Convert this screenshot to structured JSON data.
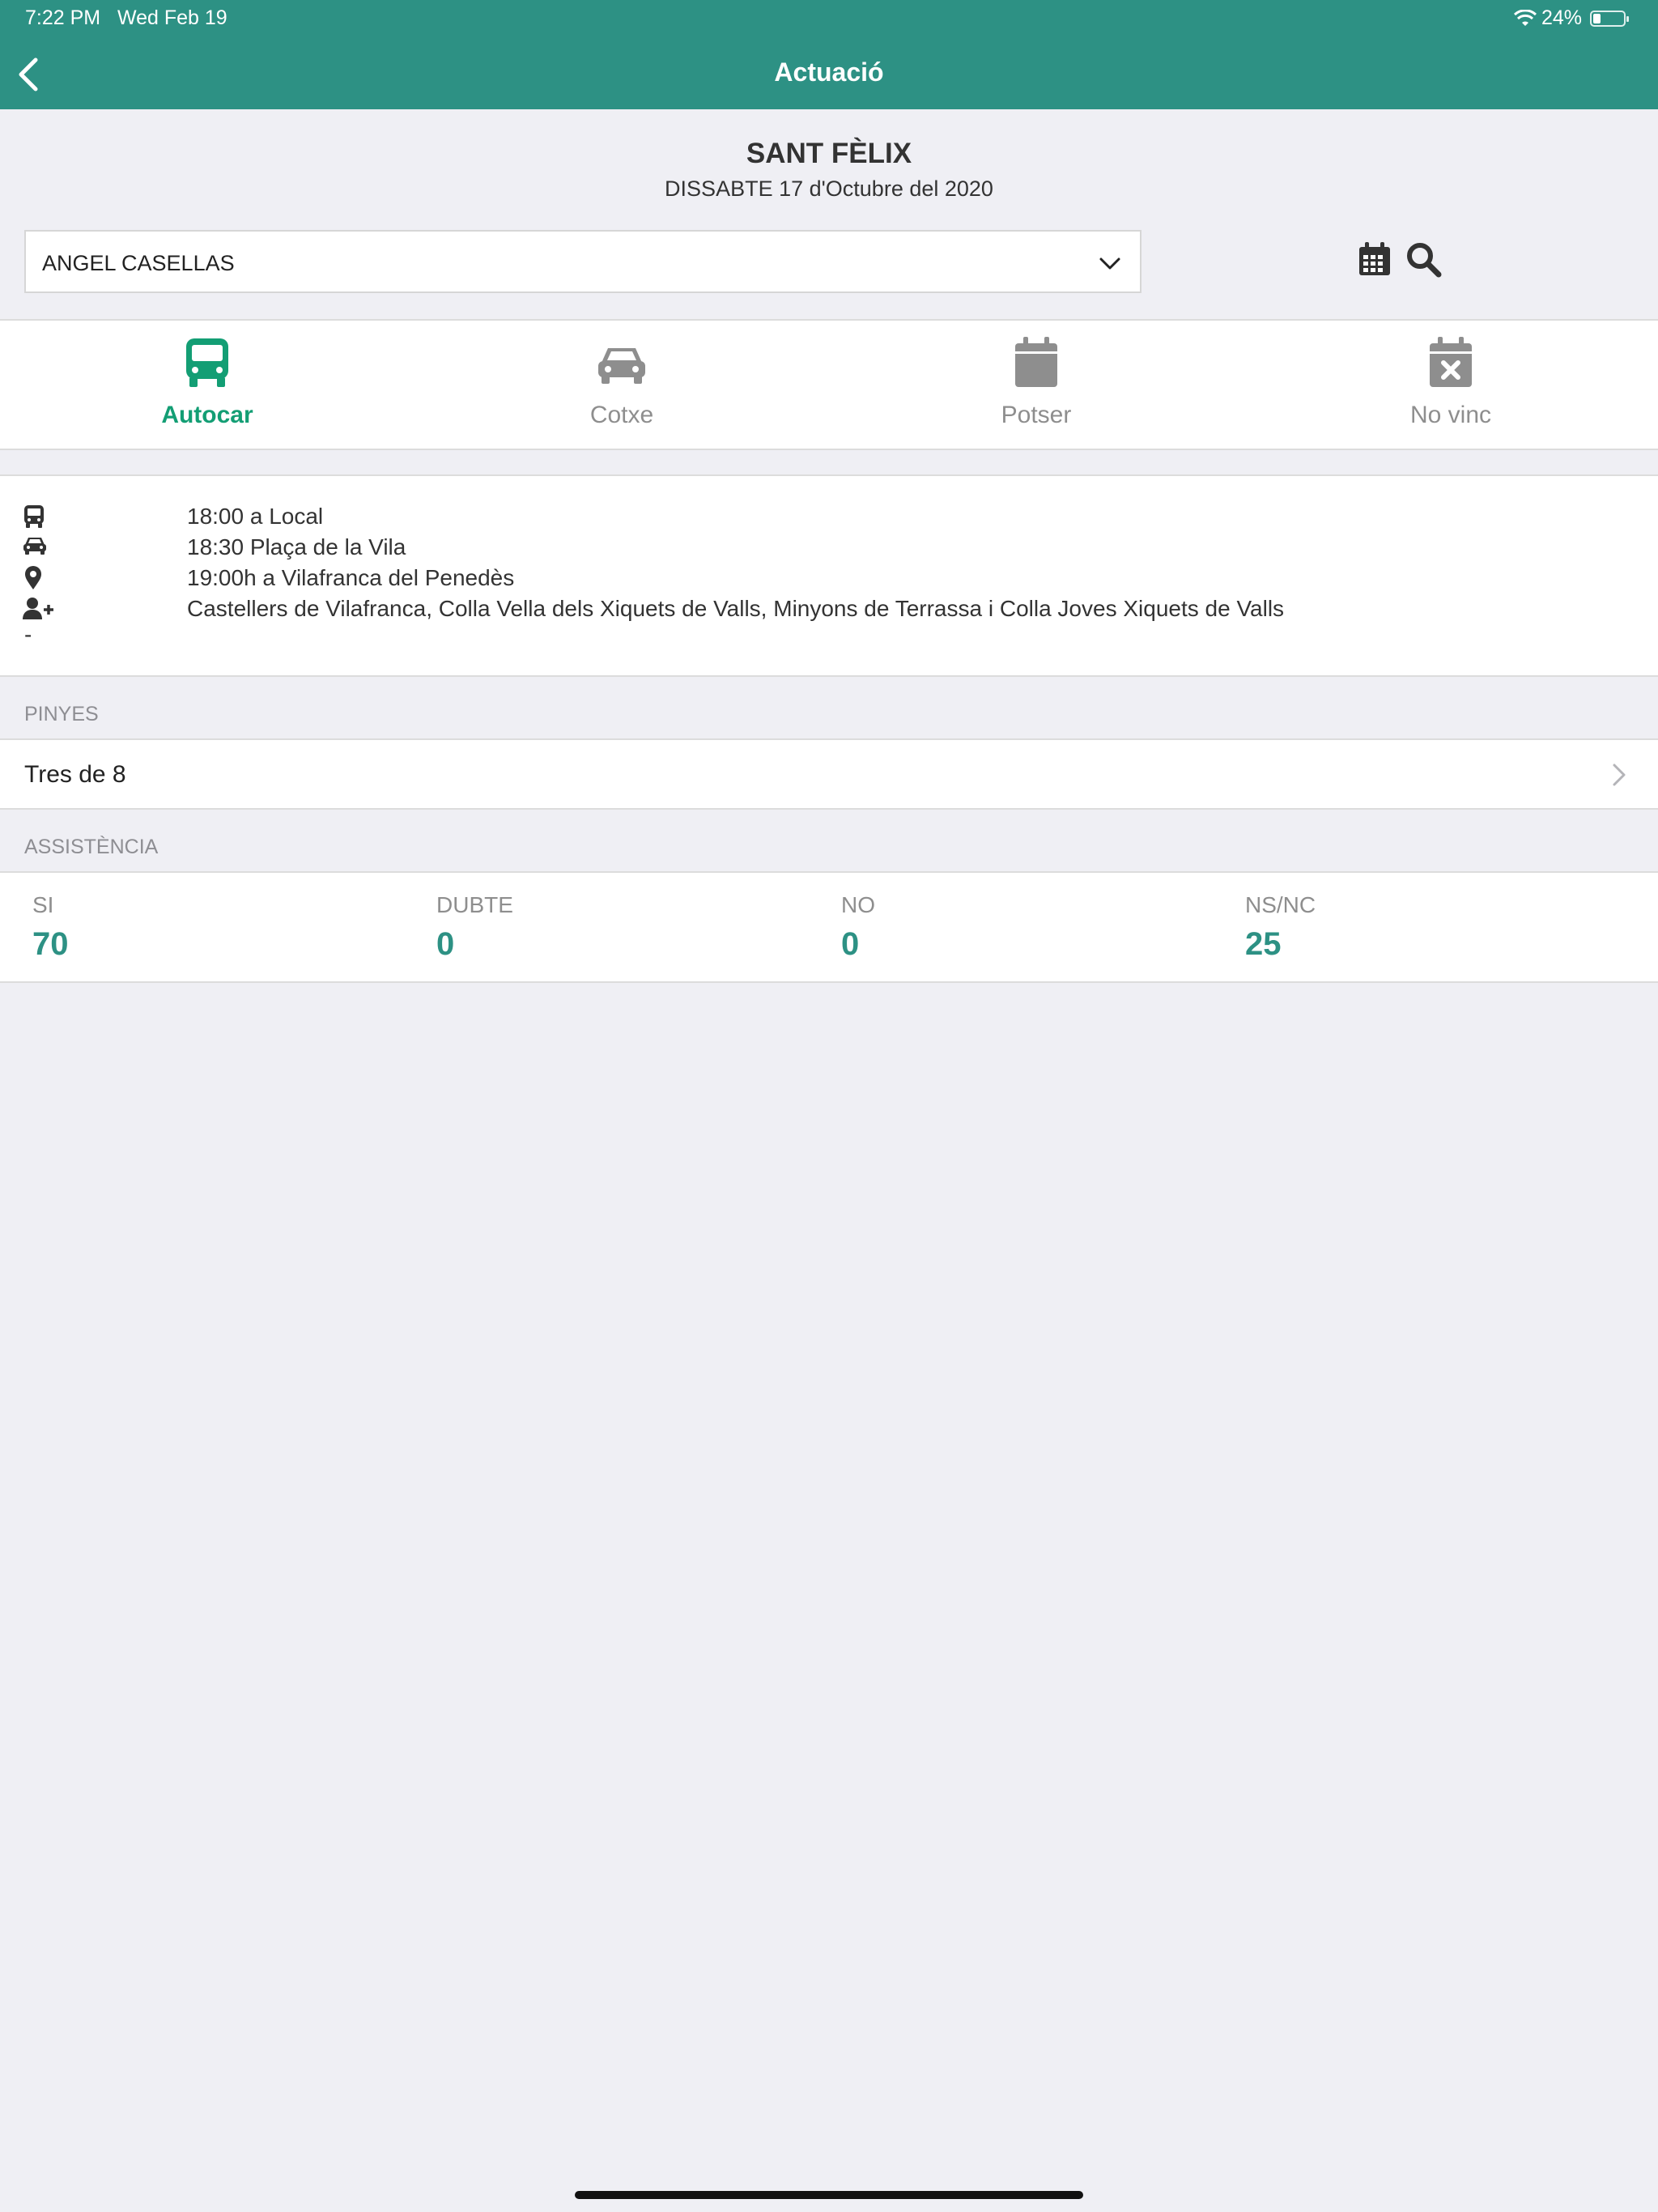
{
  "status_bar": {
    "time": "7:22 PM",
    "date": "Wed Feb 19",
    "battery": "24%"
  },
  "header": {
    "title": "Actuació"
  },
  "event": {
    "name": "SANT FÈLIX",
    "date": "DISSABTE 17 d'Octubre del 2020"
  },
  "member_select": {
    "value": "ANGEL CASELLAS"
  },
  "tabs": [
    {
      "label": "Autocar",
      "icon": "bus-icon",
      "active": true
    },
    {
      "label": "Cotxe",
      "icon": "car-icon",
      "active": false
    },
    {
      "label": "Potser",
      "icon": "calendar-icon",
      "active": false
    },
    {
      "label": "No vinc",
      "icon": "calendar-times-icon",
      "active": false
    }
  ],
  "details": {
    "bus": "18:00 a Local",
    "car": "18:30 Plaça de la Vila",
    "location": "19:00h a Vilafranca del Penedès",
    "participants": "Castellers de Vilafranca, Colla Vella dels Xiquets de Valls, Minyons de Terrassa i Colla Joves Xiquets de Valls",
    "extra": "-"
  },
  "pinyes": {
    "header": "PINYES",
    "item": "Tres de 8"
  },
  "assistencia": {
    "header": "ASSISTÈNCIA",
    "stats": [
      {
        "label": "SI",
        "value": "70"
      },
      {
        "label": "DUBTE",
        "value": "0"
      },
      {
        "label": "NO",
        "value": "0"
      },
      {
        "label": "NS/NC",
        "value": "25"
      }
    ]
  },
  "colors": {
    "header_bg": "#2d9184",
    "accent": "#139e74",
    "stat_value": "#2d9184",
    "background": "#efeff4"
  }
}
